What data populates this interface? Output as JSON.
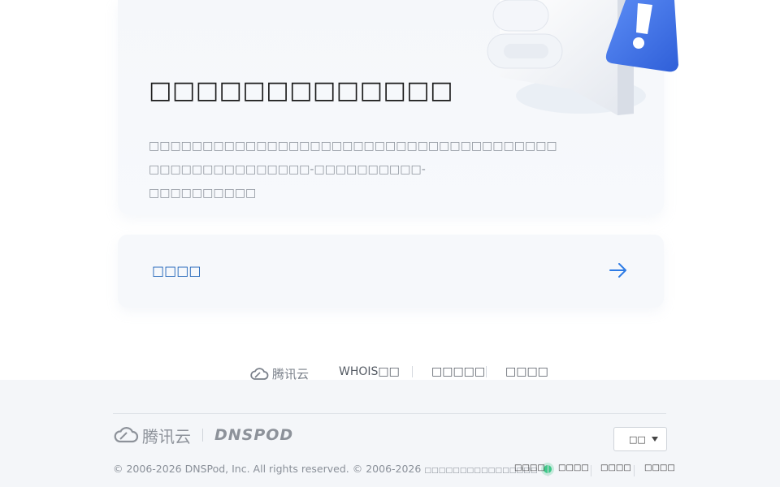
{
  "hero": {
    "title": "□□□□□□□□□□□□□",
    "description_line1": "□□□□□□□□□□□□□□□□□□□□□□□□□□□□□□□□□□□□□□",
    "description_line2": "□□□□□□□□□□□□□□□-□□□□□□□□□□-□□□□□□□□□□"
  },
  "link_card": {
    "label": "□□□□"
  },
  "sub_links": {
    "tencent_cloud": "腾讯云",
    "whois": "WHOIS□□",
    "link2": "□□□□□",
    "link3": "□□□□"
  },
  "footer": {
    "tencent_cloud": "腾讯云",
    "dnspod": "DNSPOD",
    "language": "□□",
    "copyright_main": "© 2006-2026 DNSPod, Inc. All rights reserved. © 2006-2026",
    "copyright_small": "□□□□□□□□□□□□□□□□",
    "links": [
      "□□□□",
      "□□□□",
      "□□□□",
      "□□□□"
    ]
  },
  "colors": {
    "accent": "#1d62b8",
    "warning_badge": "#3b6fe6",
    "status": "#40c98a"
  }
}
